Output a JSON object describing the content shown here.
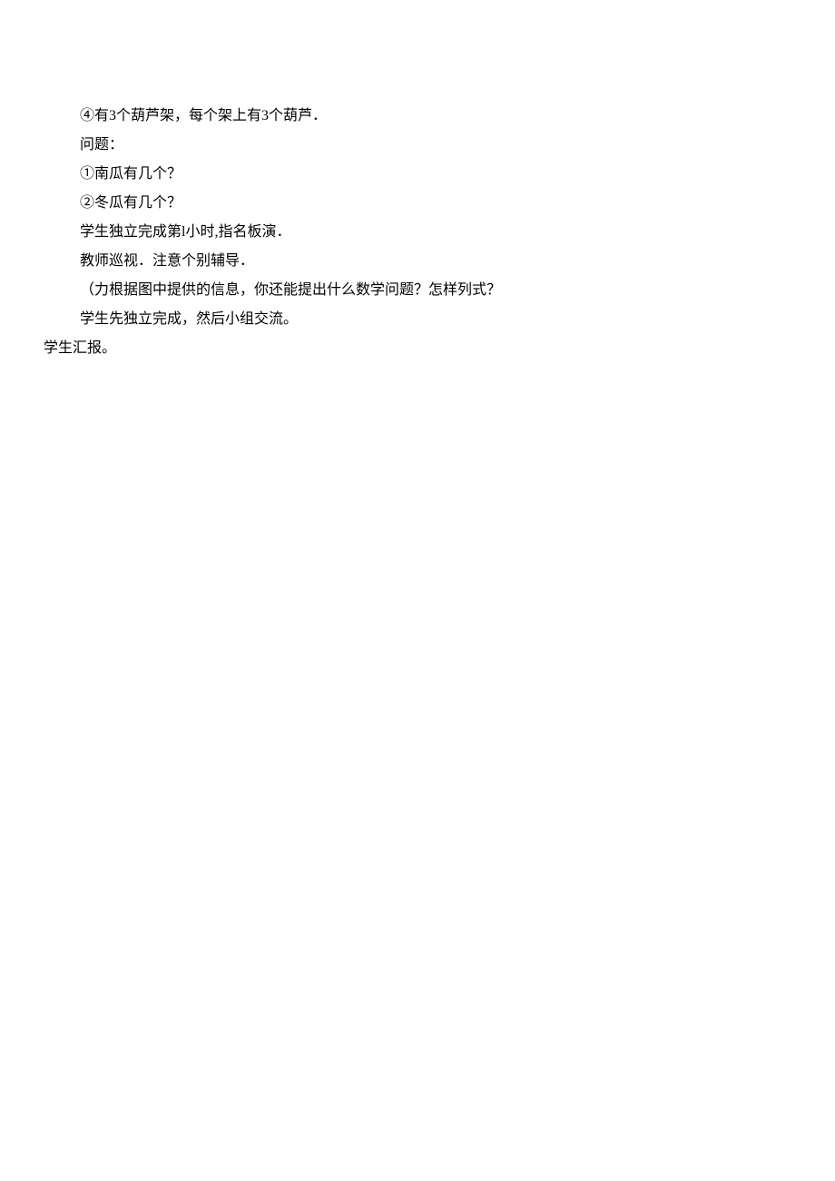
{
  "lines": {
    "l1": "④有3个葫芦架，每个架上有3个葫芦．",
    "l2": "问题：",
    "l3": "①南瓜有几个？",
    "l4": "②冬瓜有几个？",
    "l5": "学生独立完成第l小时,指名板演．",
    "l6": "教师巡视．注意个别辅导．",
    "l7": "（力根据图中提供的信息，你还能提出什么数学问题？怎样列式？",
    "l8": "学生先独立完成，然后小组交流。",
    "l9": "学生汇报。"
  }
}
